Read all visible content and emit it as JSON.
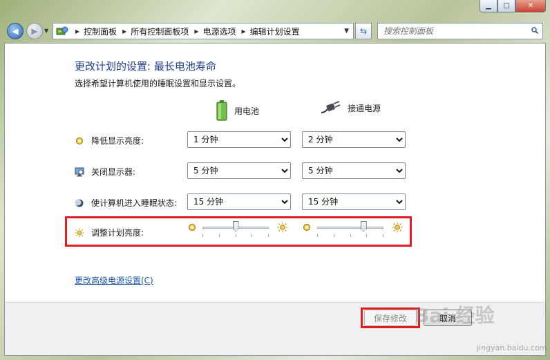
{
  "navigation": {
    "breadcrumbs": [
      "控制面板",
      "所有控制面板项",
      "电源选项",
      "编辑计划设置"
    ],
    "search_placeholder": "搜索控制面板"
  },
  "page": {
    "title": "更改计划的设置: 最长电池寿命",
    "subtitle": "选择希望计算机使用的睡眠设置和显示设置。"
  },
  "columns": {
    "battery": "用电池",
    "plugged": "接通电源"
  },
  "settings": [
    {
      "label": "降低显示亮度:",
      "battery": "1 分钟",
      "plugged": "2 分钟",
      "icon": "dim-display-icon"
    },
    {
      "label": "关闭显示器:",
      "battery": "5 分钟",
      "plugged": "5 分钟",
      "icon": "monitor-off-icon"
    },
    {
      "label": "使计算机进入睡眠状态:",
      "battery": "15 分钟",
      "plugged": "15 分钟",
      "icon": "sleep-moon-icon"
    }
  ],
  "brightness": {
    "label": "调整计划亮度:",
    "battery_level": 0.5,
    "plugged_level": 0.7
  },
  "advanced_link": "更改高级电源设置(C)",
  "buttons": {
    "save": "保存修改",
    "cancel": "取消"
  },
  "watermark": {
    "text": "Bai 经验",
    "sub": "jingyan.baidu.com"
  },
  "colors": {
    "highlight": "#e01c24",
    "title": "#1c3c8c",
    "link": "#1e57a8"
  }
}
